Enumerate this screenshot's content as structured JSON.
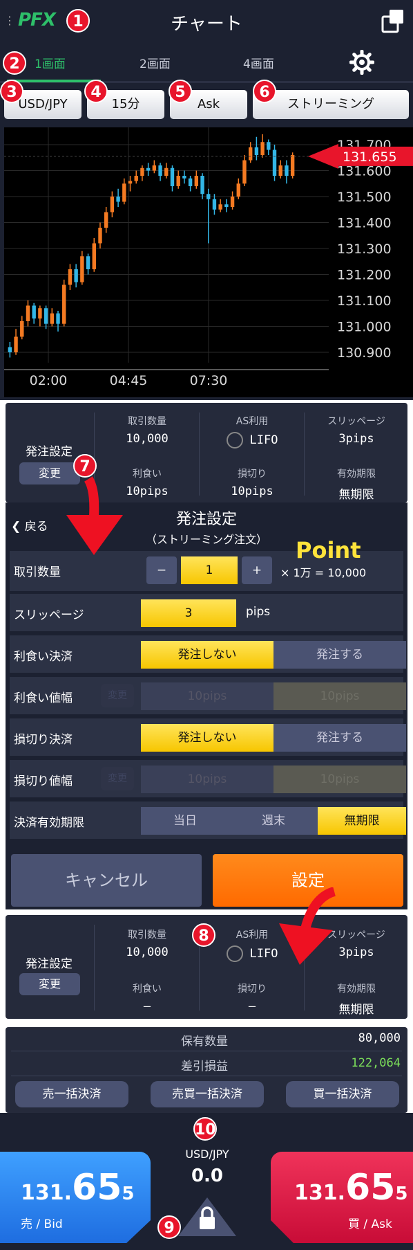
{
  "header": {
    "logo": "PFX",
    "menu": "⋮",
    "title": "チャート"
  },
  "tabs": [
    "1画面",
    "2画面",
    "4画面"
  ],
  "selectors": {
    "pair": "USD/JPY",
    "period": "15分",
    "side": "Ask",
    "mode": "ストリーミング"
  },
  "badges": [
    "1",
    "2",
    "3",
    "4",
    "5",
    "6",
    "7",
    "8",
    "9",
    "10"
  ],
  "chart": {
    "current_price": "131.655",
    "y_ticks": [
      "131.700",
      "131.600",
      "131.500",
      "131.400",
      "131.300",
      "131.200",
      "131.100",
      "131.000",
      "130.900"
    ],
    "x_ticks": [
      "02:00",
      "04:45",
      "07:30"
    ],
    "colors": {
      "up": "#f47a22",
      "down": "#33b6e6",
      "marker": "#e8152b"
    }
  },
  "chart_data": {
    "type": "candlestick",
    "ylim": [
      130.86,
      131.74
    ],
    "x_ticks": [
      "02:00",
      "04:45",
      "07:30"
    ],
    "candles": [
      [
        130.92,
        130.9,
        130.94,
        130.88
      ],
      [
        130.9,
        130.96,
        130.99,
        130.89
      ],
      [
        130.96,
        131.02,
        131.04,
        130.95
      ],
      [
        131.02,
        131.08,
        131.1,
        131.0
      ],
      [
        131.08,
        131.03,
        131.09,
        131.01
      ],
      [
        131.03,
        131.07,
        131.08,
        131.0
      ],
      [
        131.07,
        131.01,
        131.08,
        130.99
      ],
      [
        131.01,
        131.05,
        131.07,
        131.0
      ],
      [
        131.05,
        131.01,
        131.06,
        130.98
      ],
      [
        131.01,
        131.16,
        131.18,
        131.0
      ],
      [
        131.16,
        131.22,
        131.24,
        131.14
      ],
      [
        131.22,
        131.17,
        131.24,
        131.15
      ],
      [
        131.17,
        131.27,
        131.29,
        131.16
      ],
      [
        131.27,
        131.22,
        131.28,
        131.2
      ],
      [
        131.22,
        131.32,
        131.34,
        131.21
      ],
      [
        131.32,
        131.38,
        131.4,
        131.3
      ],
      [
        131.38,
        131.44,
        131.46,
        131.36
      ],
      [
        131.44,
        131.5,
        131.52,
        131.42
      ],
      [
        131.5,
        131.48,
        131.53,
        131.46
      ],
      [
        131.48,
        131.55,
        131.57,
        131.47
      ],
      [
        131.55,
        131.56,
        131.58,
        131.52
      ],
      [
        131.56,
        131.58,
        131.6,
        131.55
      ],
      [
        131.58,
        131.61,
        131.62,
        131.56
      ],
      [
        131.61,
        131.6,
        131.63,
        131.58
      ],
      [
        131.6,
        131.62,
        131.64,
        131.59
      ],
      [
        131.62,
        131.58,
        131.63,
        131.56
      ],
      [
        131.58,
        131.61,
        131.63,
        131.57
      ],
      [
        131.61,
        131.54,
        131.62,
        131.52
      ],
      [
        131.54,
        131.58,
        131.6,
        131.53
      ],
      [
        131.58,
        131.57,
        131.6,
        131.55
      ],
      [
        131.57,
        131.54,
        131.58,
        131.52
      ],
      [
        131.54,
        131.58,
        131.6,
        131.53
      ],
      [
        131.58,
        131.51,
        131.59,
        131.49
      ],
      [
        131.51,
        131.49,
        131.53,
        131.32
      ],
      [
        131.49,
        131.45,
        131.51,
        131.43
      ],
      [
        131.45,
        131.47,
        131.49,
        131.44
      ],
      [
        131.47,
        131.46,
        131.49,
        131.44
      ],
      [
        131.46,
        131.5,
        131.52,
        131.45
      ],
      [
        131.5,
        131.55,
        131.57,
        131.49
      ],
      [
        131.55,
        131.64,
        131.66,
        131.54
      ],
      [
        131.64,
        131.69,
        131.71,
        131.63
      ],
      [
        131.69,
        131.66,
        131.73,
        131.64
      ],
      [
        131.66,
        131.71,
        131.74,
        131.65
      ],
      [
        131.71,
        131.68,
        131.72,
        131.66
      ],
      [
        131.68,
        131.58,
        131.7,
        131.56
      ],
      [
        131.58,
        131.62,
        131.64,
        131.57
      ],
      [
        131.62,
        131.58,
        131.64,
        131.55
      ],
      [
        131.58,
        131.66,
        131.67,
        131.57
      ]
    ],
    "last_price": 131.655
  },
  "order_summary_top": {
    "title": "発注設定",
    "change": "変更",
    "qty_h": "取引数量",
    "qty_v": "10,000",
    "as_h": "AS利用",
    "as_v": "LIFO",
    "slip_h": "スリッページ",
    "slip_v": "3pips",
    "tp_h": "利食い",
    "tp_v": "10pips",
    "sl_h": "損切り",
    "sl_v": "10pips",
    "exp_h": "有効期限",
    "exp_v": "無期限"
  },
  "dialog": {
    "back": "戻る",
    "title": "発注設定",
    "subtitle": "（ストリーミング注文）",
    "point": "Point",
    "qty_label": "取引数量",
    "minus": "−",
    "qty": "1",
    "plus": "+",
    "qty_formula": "× 1万 = 10,000",
    "slip_label": "スリッページ",
    "slip": "3",
    "slip_unit": "pips",
    "tp_label": "利食い決済",
    "no_order": "発注しない",
    "order": "発注する",
    "tp_width_label": "利食い値幅",
    "sl_label": "損切り決済",
    "sl_width_label": "損切り値幅",
    "change_small": "変更",
    "width_left": "10pips",
    "width_right": "10pips",
    "exp_label": "決済有効期限",
    "exp_today": "当日",
    "exp_week": "週末",
    "exp_none": "無期限",
    "cancel": "キャンセル",
    "set": "設定"
  },
  "order_summary_bottom": {
    "title": "発注設定",
    "change": "変更",
    "qty_h": "取引数量",
    "qty_v": "10,000",
    "as_h": "AS利用",
    "as_v": "LIFO",
    "slip_h": "スリッページ",
    "slip_v": "3pips",
    "tp_h": "利食い",
    "tp_v": "–",
    "sl_h": "損切り",
    "sl_v": "–",
    "exp_h": "有効期限",
    "exp_v": "無期限"
  },
  "position": {
    "hold_label": "保有数量",
    "hold_value": "80,000",
    "pnl_label": "差引損益",
    "pnl_value": "122,064",
    "pnl_color": "#7ce05a",
    "sell_all": "売一括決済",
    "both_all": "売買一括決済",
    "buy_all": "買一括決済"
  },
  "trade": {
    "pair": "USD/JPY",
    "spread": "0.0",
    "bid_a": "131.",
    "bid_b": "65",
    "bid_c": "5",
    "bid_label": "売 / Bid",
    "ask_a": "131.",
    "ask_b": "65",
    "ask_c": "5",
    "ask_label": "買 / Ask"
  }
}
